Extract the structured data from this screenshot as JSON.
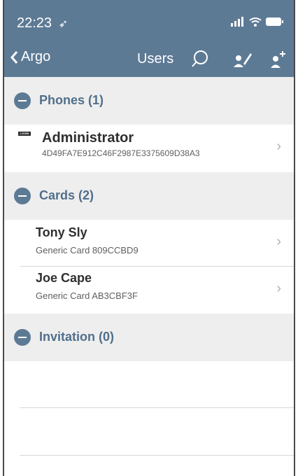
{
  "status_bar": {
    "time": "22:23"
  },
  "navbar": {
    "back_label": "Argo",
    "title": "Users"
  },
  "sections": [
    {
      "title": "Phones (1)",
      "rows": [
        {
          "name": "Administrator",
          "subtitle": "4D49FA7E912C46F2987E3375609D38A3",
          "badge": "LOGIN"
        }
      ]
    },
    {
      "title": "Cards (2)",
      "rows": [
        {
          "name": "Tony Sly",
          "subtitle": "Generic Card 809CCBD9"
        },
        {
          "name": "Joe Cape",
          "subtitle": "Generic Card AB3CBF3F"
        }
      ]
    },
    {
      "title": "Invitation (0)",
      "rows": []
    }
  ],
  "colors": {
    "accent": "#5d7a95",
    "section_bg": "#eeeeee",
    "section_text": "#516f8b"
  },
  "icons": [
    "location-arrow-icon",
    "signal-icon",
    "wifi-icon",
    "battery-icon",
    "back-chevron-icon",
    "search-icon",
    "user-edit-icon",
    "user-add-icon",
    "minus-circle-icon",
    "chevron-right-icon"
  ]
}
